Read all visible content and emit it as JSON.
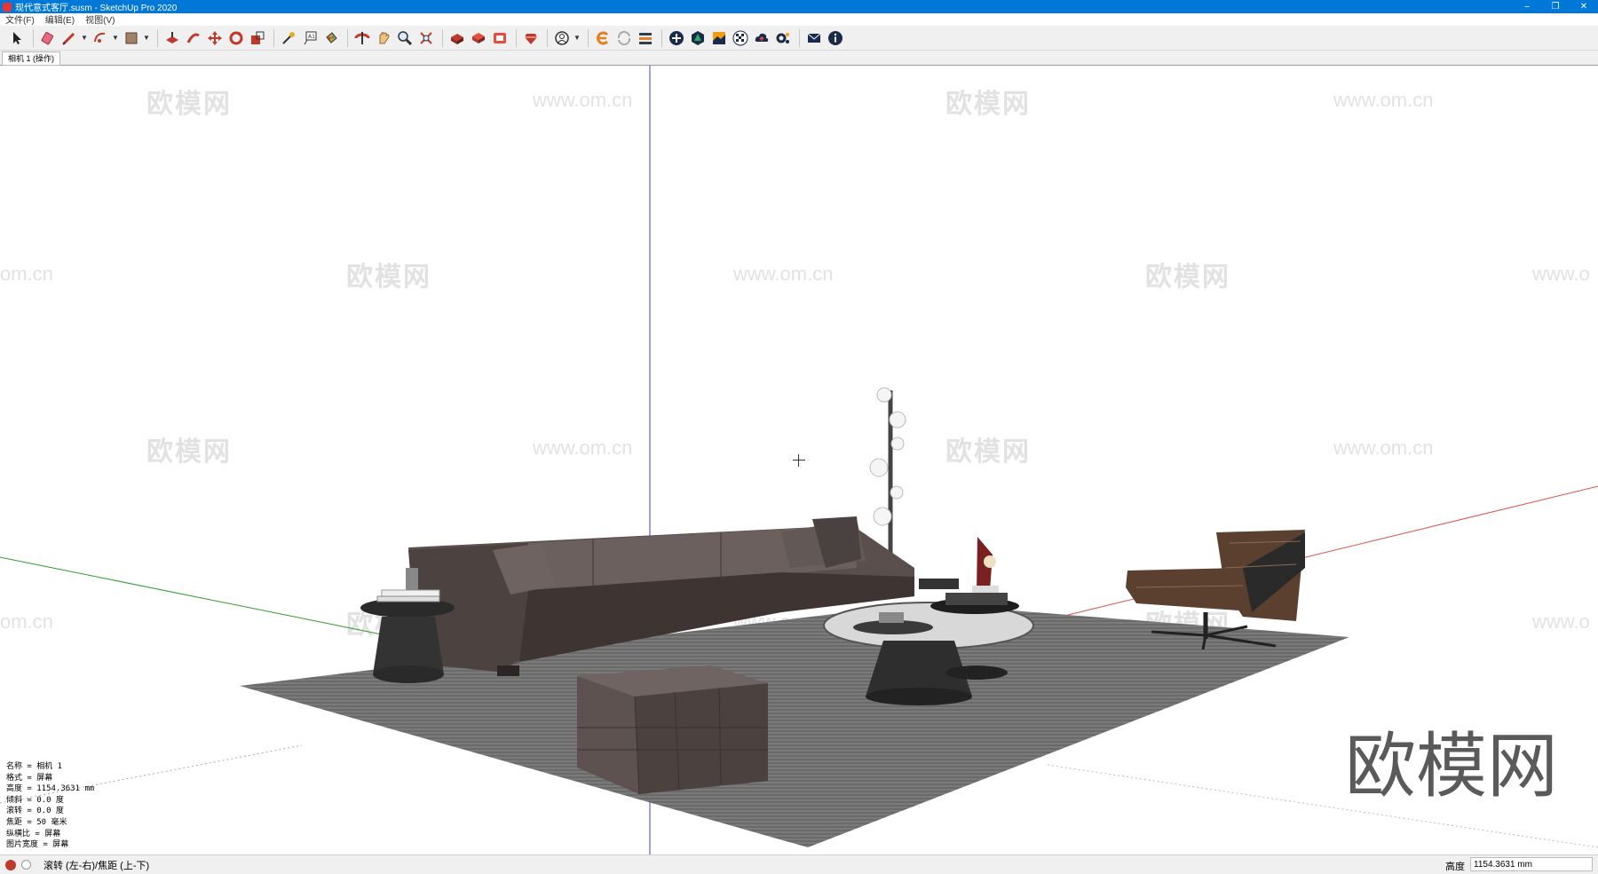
{
  "window": {
    "title": "现代意式客厅.susm - SketchUp Pro 2020",
    "minimize": "–",
    "restore": "❐",
    "close": "✕"
  },
  "menu": [
    "文件(F)",
    "编辑(E)",
    "视图(V)"
  ],
  "toolbar": {
    "tools": [
      "select-tool",
      "eraser-tool",
      "line-tool",
      "arc-tool",
      "shape-tool",
      "move-tool",
      "push-pull-tool",
      "move-arrows-tool",
      "rotate-tool",
      "scale-tool",
      "tape-measure-tool",
      "text-tool",
      "paint-bucket-tool",
      "orbit-tool",
      "pan-tool",
      "zoom-tool",
      "zoom-extents-tool",
      "warehouse-tool",
      "components-tool",
      "extensions-tool",
      "ruby-tool",
      "account-tool",
      "plugin-e-tool",
      "sync-tool",
      "layers-tool",
      "add-tool",
      "tree-tool",
      "terrain-tool",
      "checker-tool",
      "cloud-tool",
      "settings-tool",
      "mail-tool",
      "info-tool"
    ]
  },
  "scene": {
    "tab_label": "相机 1 (操作)"
  },
  "watermarks": {
    "brand": "欧模网",
    "url": "www.om.cn",
    "partial_url": "om.cn",
    "partial_url_right": "www.o"
  },
  "big_watermark": "欧模网",
  "camera_info": [
    "名称 = 相机 1",
    "格式 = 屏幕",
    "高度 = 1154.3631 mm",
    "倾斜 = 0.0 度",
    "滚转 = 0.0 度",
    "焦距 = 50 毫米",
    "纵横比 = 屏幕",
    "图片宽度 = 屏幕"
  ],
  "status": {
    "hint": "滚转 (左-右)/焦距 (上-下)",
    "measure_label": "高度",
    "measure_value": "1154.3631 mm"
  },
  "colors": {
    "titlebar": "#0078d7",
    "red_axis": "#d9534f",
    "green_axis": "#2e9b2e",
    "blue_axis": "#4040c0",
    "rug": "#6e6e6e",
    "sofa": "#5a4f4c"
  }
}
